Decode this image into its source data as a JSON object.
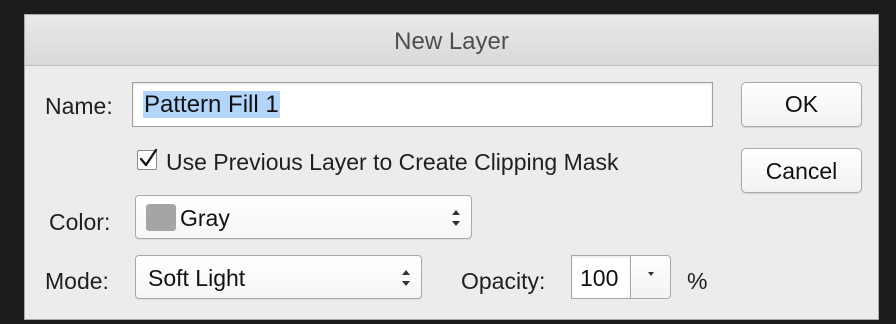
{
  "dialog": {
    "title": "New Layer"
  },
  "name": {
    "label": "Name:",
    "value": "Pattern Fill 1"
  },
  "clipping_mask": {
    "label": "Use Previous Layer to Create Clipping Mask",
    "checked": true
  },
  "color": {
    "label": "Color:",
    "selected": "Gray",
    "swatch_color": "#a5a5a5"
  },
  "mode": {
    "label": "Mode:",
    "selected": "Soft Light"
  },
  "opacity": {
    "label": "Opacity:",
    "value": "100",
    "unit": "%"
  },
  "buttons": {
    "ok": "OK",
    "cancel": "Cancel"
  },
  "icons": {
    "checkmark": "checkmark-icon",
    "select_arrows": "up-down-arrows-icon",
    "dropdown": "small-dropdown-arrow-icon"
  }
}
